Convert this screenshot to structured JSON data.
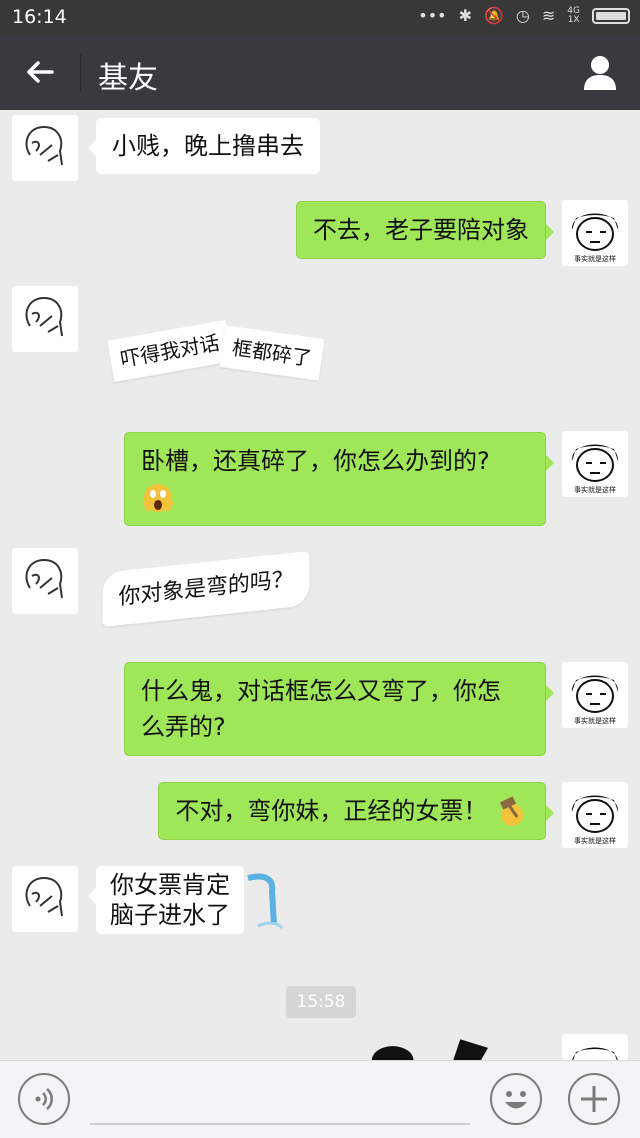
{
  "status_bar": {
    "time": "16:14",
    "network": "4G\n1X"
  },
  "header": {
    "title": "基友"
  },
  "messages": [
    {
      "side": "left",
      "text": "小贱，晚上撸串去"
    },
    {
      "side": "right",
      "text": "不去，老子要陪对象",
      "avatar_caption": "事实就是这样"
    },
    {
      "side": "left",
      "text_a": "吓得我对话",
      "text_b": "框都碎了"
    },
    {
      "side": "right",
      "text": "卧槽，还真碎了，你怎么办到的?",
      "emoji": "scream-emoji",
      "avatar_caption": "事实就是这样"
    },
    {
      "side": "left",
      "text": "你对象是弯的吗？"
    },
    {
      "side": "right",
      "line1": "什么鬼，对话框怎么又弯了，你怎",
      "line2": "么弄的?",
      "avatar_caption": "事实就是这样"
    },
    {
      "side": "right",
      "text": "不对，弯你妹，正经的女票！",
      "emoji": "hammer-emoji",
      "avatar_caption": "事实就是这样"
    },
    {
      "side": "left",
      "line1": "你女票肯定",
      "line2": "脑子进水了",
      "emoji": "waterfall-emoji"
    }
  ],
  "timestamp": "15:58",
  "colors": {
    "accent_green": "#9fe658",
    "titlebar": "#393a3f",
    "chat_bg": "#ebebeb"
  },
  "icons": [
    "back-arrow-icon",
    "profile-icon",
    "voice-icon",
    "emoji-icon",
    "plus-icon"
  ]
}
